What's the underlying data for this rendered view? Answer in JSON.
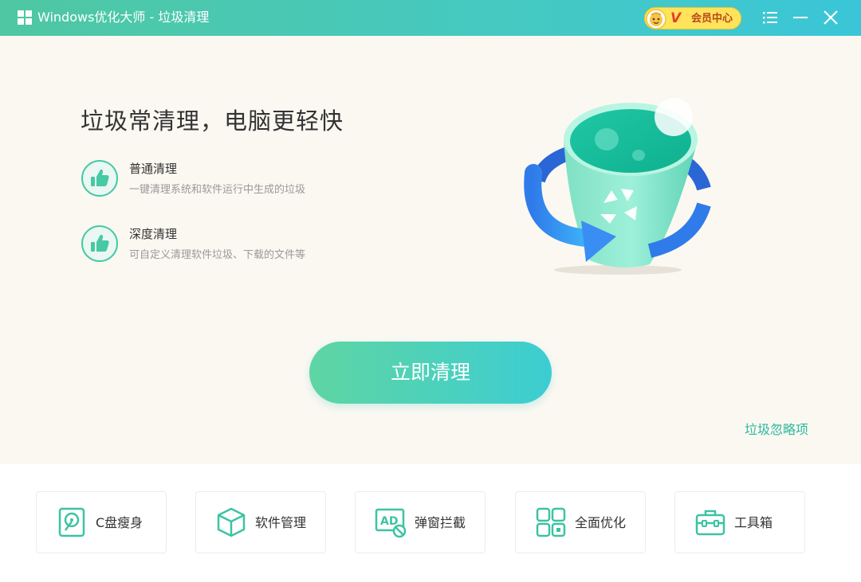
{
  "window": {
    "title": "Windows优化大师 - 垃圾清理",
    "vip_v": "V",
    "vip_label": "会员中心"
  },
  "main": {
    "headline": "垃圾常清理，电脑更轻快",
    "features": [
      {
        "title": "普通清理",
        "desc": "一键清理系统和软件运行中生成的垃圾",
        "icon": "thumbs-up-icon"
      },
      {
        "title": "深度清理",
        "desc": "可自定义清理软件垃圾、下载的文件等",
        "icon": "thumbs-up-icon"
      }
    ],
    "clean_button": "立即清理",
    "ignore_link": "垃圾忽略项"
  },
  "tools": [
    {
      "label": "C盘瘦身",
      "icon": "disk-icon"
    },
    {
      "label": "软件管理",
      "icon": "cube-icon"
    },
    {
      "label": "弹窗拦截",
      "icon": "ad-block-icon"
    },
    {
      "label": "全面优化",
      "icon": "optimize-icon"
    },
    {
      "label": "工具箱",
      "icon": "toolbox-icon"
    }
  ],
  "colors": {
    "titlebar_start": "#4fc7a2",
    "titlebar_end": "#3ac6d8",
    "accent": "#2bb89c",
    "background": "#fbf8f2",
    "vip": "#ffe35a"
  }
}
